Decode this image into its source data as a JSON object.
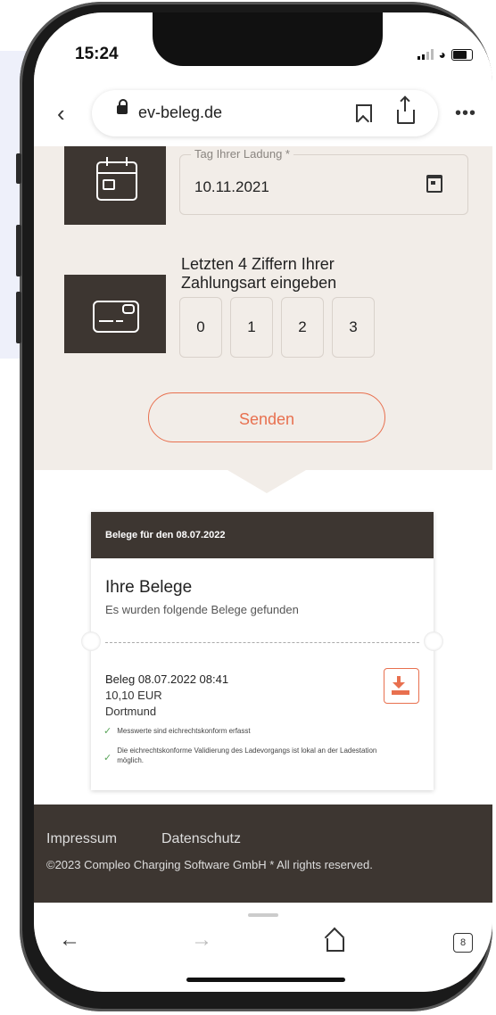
{
  "status": {
    "time": "15:24"
  },
  "browser": {
    "url": "ev-beleg.de",
    "tab_count": "8"
  },
  "form": {
    "date_label": "Tag Ihrer Ladung *",
    "date_value": "10.11.2021",
    "digits_label": "Letzten 4 Ziffern Ihrer Zahlungsart eingeben",
    "digits": [
      "0",
      "1",
      "2",
      "3"
    ],
    "send_label": "Senden"
  },
  "receipts": {
    "header": "Belege für den 08.07.2022",
    "title": "Ihre Belege",
    "subtitle": "Es wurden folgende Belege gefunden",
    "item": {
      "title": "Beleg 08.07.2022 08:41",
      "amount": "10,10 EUR",
      "city": "Dortmund",
      "check1": "Messwerte sind eichrechtskonform erfasst",
      "check2": "Die eichrechtskonforme Validierung des Ladevorgangs ist lokal an der Ladestation möglich."
    }
  },
  "footer": {
    "impressum": "Impressum",
    "datenschutz": "Datenschutz",
    "copyright": "©2023 Compleo Charging Software GmbH * All rights reserved."
  },
  "colors": {
    "accent": "#e8704f",
    "dark": "#3d3631",
    "page_bg": "#f2ede8"
  }
}
